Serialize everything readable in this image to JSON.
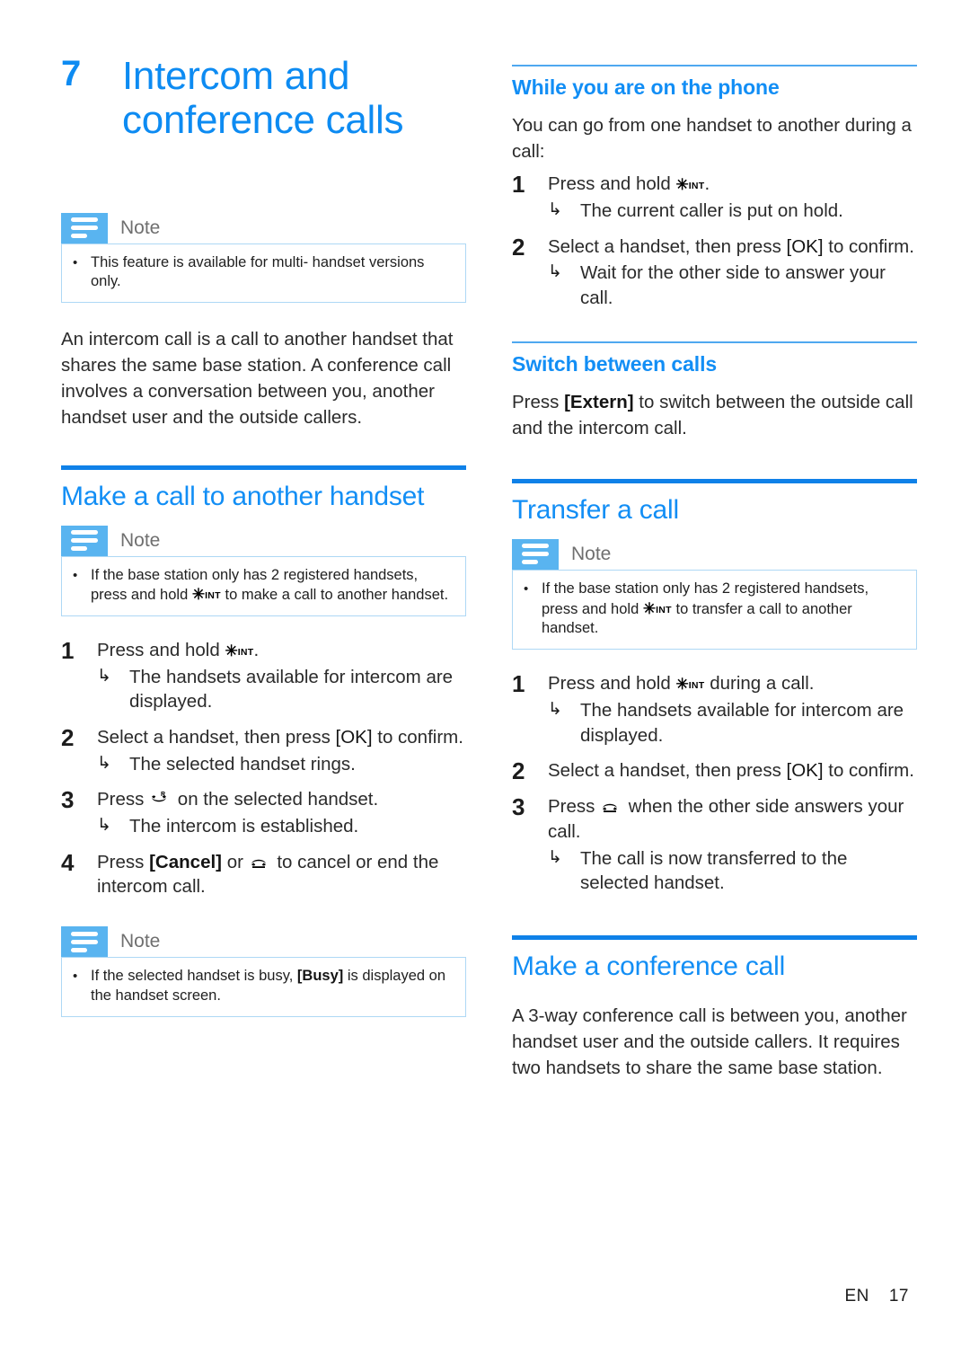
{
  "chapter": {
    "number": "7",
    "title_line1": "Intercom and",
    "title_line2": "conference calls"
  },
  "note_label": "Note",
  "icons": {
    "int_key": "asterisk-int-key-icon",
    "int_star": "✳",
    "int_suffix": "INT",
    "talk_key": "talk-handset-r-icon",
    "hangup_key": "hangup-handset-icon",
    "note": "note-bars-icon",
    "result_arrow": "↳"
  },
  "colors": {
    "accent": "#128ef5",
    "rule_thick": "#0f81e8",
    "rule_thin": "#4fa8f0",
    "note_icon_bg": "#59b4f0",
    "note_border": "#aed8f5",
    "body_text": "#2b2b2b"
  },
  "left_column": {
    "intro_note": {
      "bullet": "•",
      "text": "This feature is available for multi- handset versions only."
    },
    "intro_paragraph": "An intercom call is a call to another handset that shares the same base station. A conference call involves a conversation between you, another handset user and the outside callers.",
    "section": {
      "heading": "Make a call to another handset",
      "note": {
        "bullet": "•",
        "text_before": "If the base station only has 2 registered handsets, press and hold ",
        "text_after": " to make a call to another handset."
      },
      "steps": [
        {
          "num": "1",
          "text_before": "Press and hold ",
          "text_after": ".",
          "results": [
            "The handsets available for intercom are displayed."
          ]
        },
        {
          "num": "2",
          "text_before": "Select a handset, then press ",
          "key": "[OK]",
          "text_after": " to confirm.",
          "results": [
            "The selected handset rings."
          ]
        },
        {
          "num": "3",
          "text_before": "Press ",
          "text_after": " on the selected handset.",
          "results": [
            "The intercom is established."
          ]
        },
        {
          "num": "4",
          "text_before": "Press ",
          "key": "[Cancel]",
          "text_mid": " or ",
          "text_after": " to cancel or end the intercom call.",
          "results": []
        }
      ],
      "trailing_note": {
        "bullet": "•",
        "text_before": "If the selected handset is busy, ",
        "key": "[Busy]",
        "text_after": " is displayed on the handset screen."
      }
    }
  },
  "right_column": {
    "while_on_phone": {
      "heading": "While you are on the phone",
      "intro": "You can go from one handset to another during a call:",
      "steps": [
        {
          "num": "1",
          "text_before": "Press and hold ",
          "text_after": ".",
          "results": [
            "The current caller is put on hold."
          ]
        },
        {
          "num": "2",
          "text_before": "Select a handset, then press ",
          "key": "[OK]",
          "text_after": " to confirm.",
          "results": [
            "Wait for the other side to answer your call."
          ]
        }
      ]
    },
    "switch_between_calls": {
      "heading": "Switch between calls",
      "text_before": "Press ",
      "key": "[Extern]",
      "text_after": " to switch between the outside call and the intercom call."
    },
    "transfer_a_call": {
      "heading": "Transfer a call",
      "note": {
        "bullet": "•",
        "text_before": "If the base station only has 2 registered handsets, press and hold ",
        "text_after": " to transfer a call to another handset."
      },
      "steps": [
        {
          "num": "1",
          "text_before": "Press and hold ",
          "text_after": " during a call.",
          "results": [
            "The handsets available for intercom are displayed."
          ]
        },
        {
          "num": "2",
          "text_before": "Select a handset, then press ",
          "key": "[OK]",
          "text_after": " to confirm.",
          "results": []
        },
        {
          "num": "3",
          "text_before": "Press ",
          "text_after": " when the other side answers your call.",
          "results": [
            "The call is now transferred to the selected handset."
          ]
        }
      ]
    },
    "conference_call": {
      "heading": "Make a conference call",
      "paragraph": "A 3-way conference call is between you, another handset user and the outside callers. It requires two handsets to share the same base station."
    }
  },
  "footer": {
    "language": "EN",
    "page": "17"
  }
}
